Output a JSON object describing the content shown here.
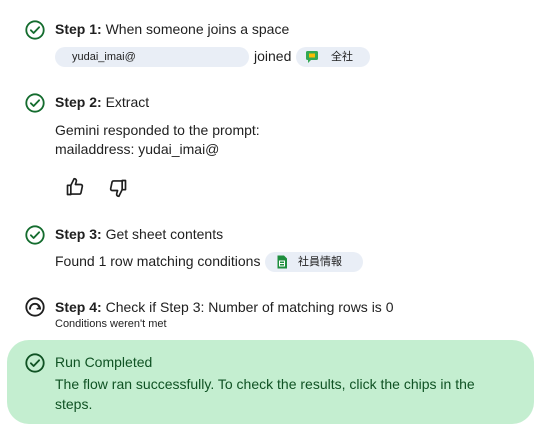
{
  "step1": {
    "label": "Step 1:",
    "title": "When someone joins a space",
    "user_chip": "yudai_imai@",
    "joined": "joined",
    "space_chip": "全社",
    "space_icon": "google-chat-icon"
  },
  "step2": {
    "label": "Step 2:",
    "title": "Extract",
    "response_line1": "Gemini responded to the prompt:",
    "response_line2": "mailaddress: yudai_imai@"
  },
  "step3": {
    "label": "Step 3:",
    "title": "Get sheet contents",
    "result": "Found 1 row matching conditions",
    "sheet_chip": "社員情報",
    "sheet_icon": "google-sheets-icon"
  },
  "step4": {
    "label": "Step 4:",
    "title": "Check if Step 3: Number of matching rows is 0",
    "note": "Conditions weren't met"
  },
  "run": {
    "title": "Run Completed",
    "message": "The flow ran successfully. To check the results, click the chips in the steps."
  },
  "colors": {
    "check": "#146c2e",
    "completed_bg": "#c4eed0",
    "completed_text": "#0f5223",
    "chip_bg": "#e9eef6",
    "sheets_green": "#1e8e3e",
    "chat_yellow": "#fbbc04",
    "chat_green": "#34a853"
  }
}
